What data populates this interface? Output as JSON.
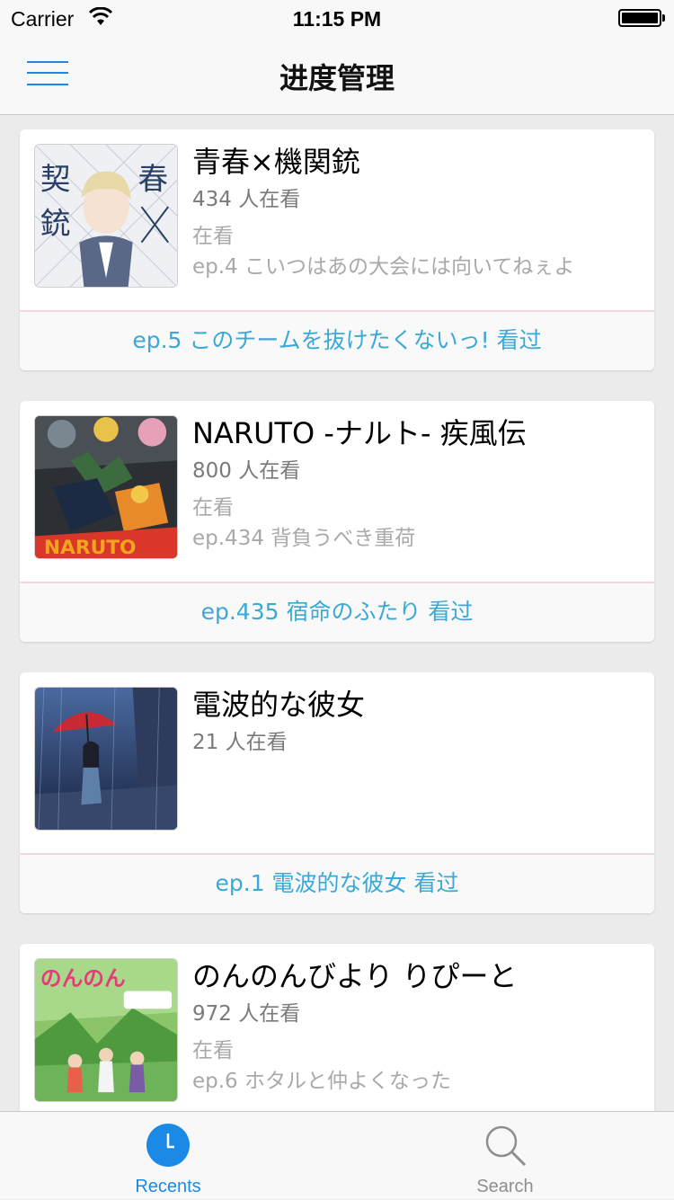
{
  "status_bar": {
    "carrier": "Carrier",
    "time": "11:15 PM"
  },
  "nav": {
    "title": "进度管理"
  },
  "colors": {
    "accent": "#1a8ae6",
    "link": "#3aa9d6",
    "divider": "#f5d6da"
  },
  "items": [
    {
      "name": "青春×機関銃",
      "watchers": "434 人在看",
      "status": "在看",
      "last_ep": "ep.4 こいつはあの大会には向いてねぇよ",
      "next_action": "ep.5 このチームを抜けたくないっ! 看过"
    },
    {
      "name": "NARUTO -ナルト- 疾風伝",
      "watchers": "800 人在看",
      "status": "在看",
      "last_ep": "ep.434 背負うべき重荷",
      "next_action": "ep.435 宿命のふたり 看过"
    },
    {
      "name": "電波的な彼女",
      "watchers": "21 人在看",
      "status": "",
      "last_ep": "",
      "next_action": "ep.1 電波的な彼女 看过"
    },
    {
      "name": "のんのんびより りぴーと",
      "watchers": "972 人在看",
      "status": "在看",
      "last_ep": "ep.6 ホタルと仲よくなった",
      "next_action": ""
    }
  ],
  "tabs": {
    "recents_label": "Recents",
    "search_label": "Search"
  }
}
